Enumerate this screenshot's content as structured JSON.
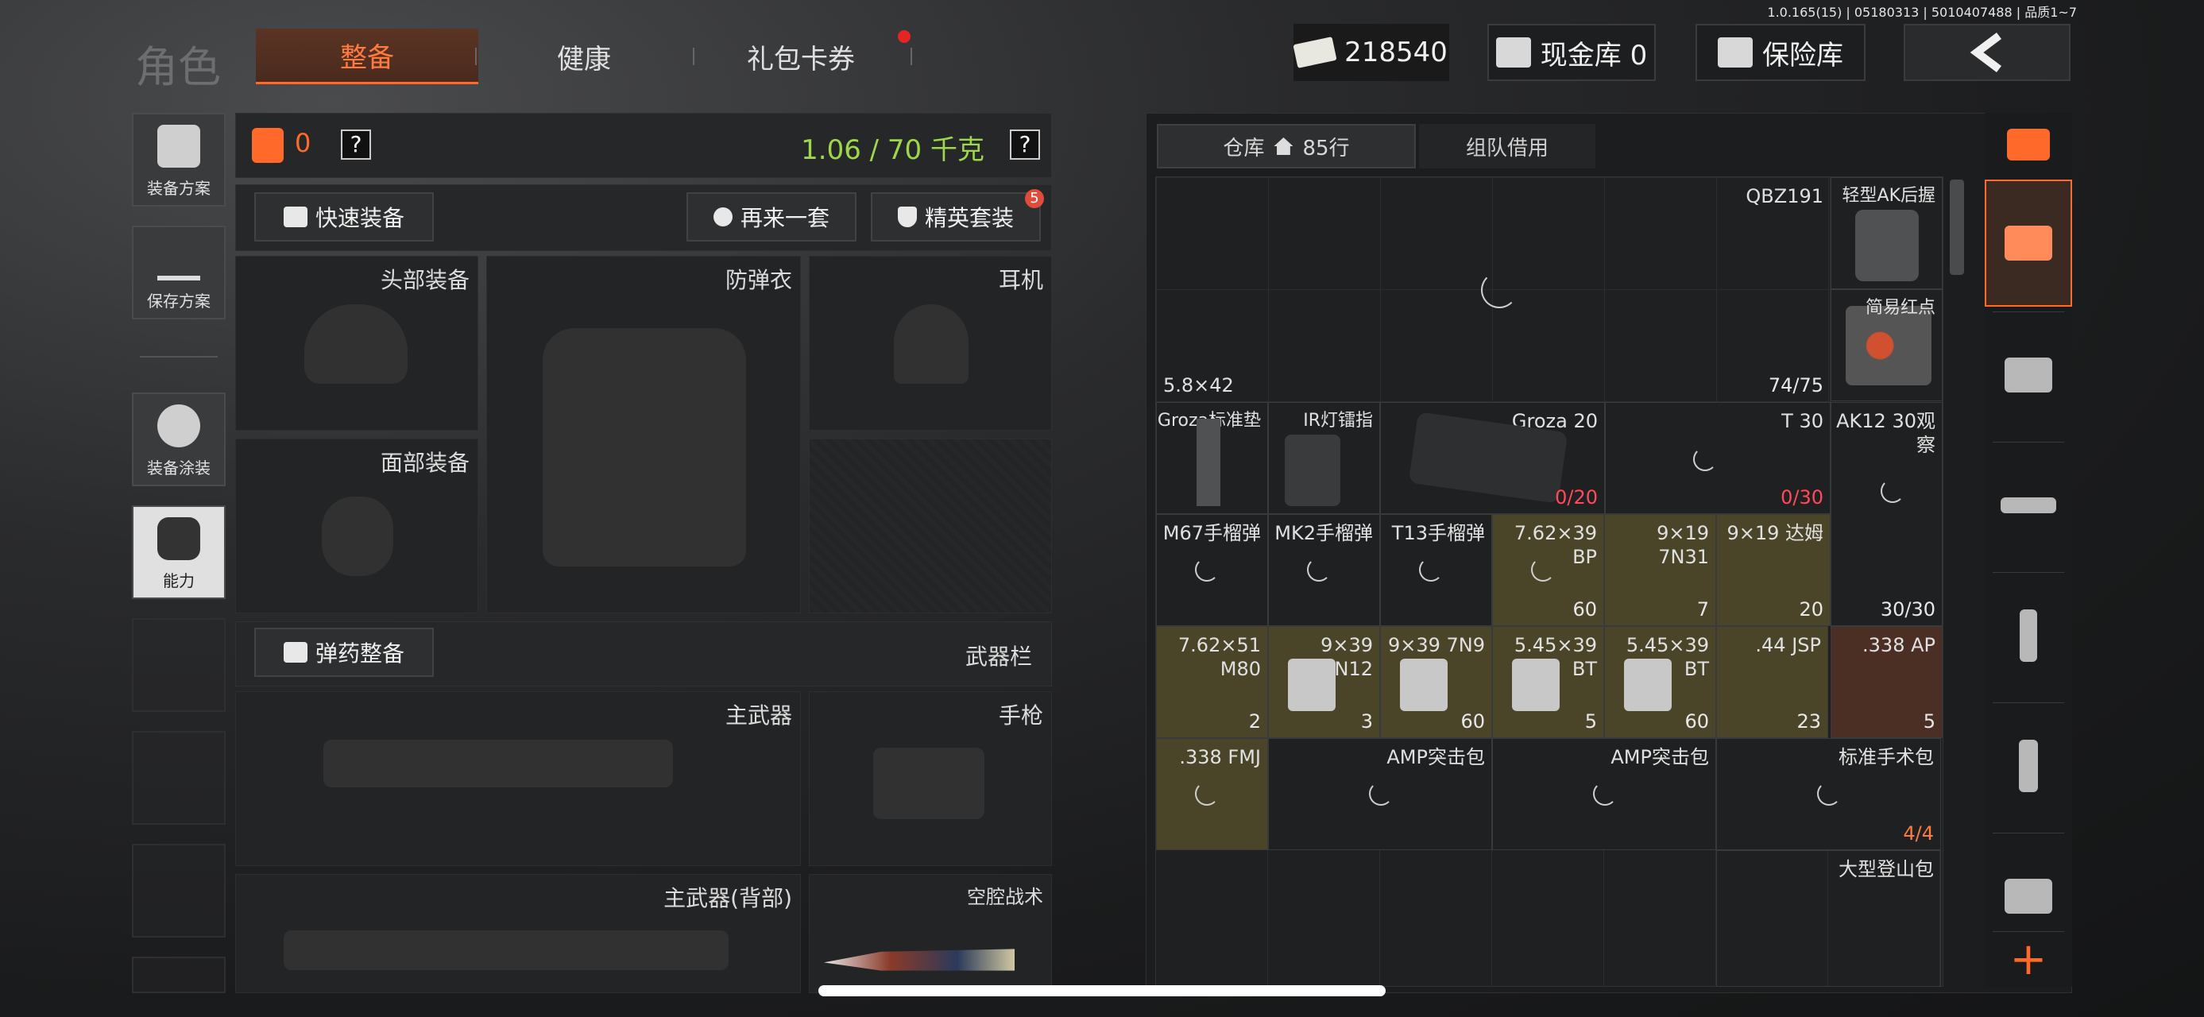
{
  "version": "1.0.165(15) | 05180313 | 5010407488 | 品质1~7",
  "header": {
    "title": "角色",
    "tabs": [
      "整备",
      "健康",
      "礼包卡券"
    ],
    "currency": "218540",
    "cash_vault": "现金库 0",
    "safe": "保险库"
  },
  "sidebar": {
    "loadout": "装备方案",
    "save": "保存方案",
    "skin": "装备涂装",
    "ability": "能力"
  },
  "equip": {
    "armor_count": "0",
    "weight": "1.06 / 70 千克",
    "quick_equip": "快速装备",
    "again": "再来一套",
    "elite": "精英套装",
    "elite_badge": "5",
    "head": "头部装备",
    "vest": "防弹衣",
    "headset": "耳机",
    "face": "面部装备",
    "ammo_equip": "弹药整备",
    "weapon_bar": "武器栏",
    "primary": "主武器",
    "pistol": "手枪",
    "primary_back": "主武器(背部)",
    "melee": "空腔战术"
  },
  "storage": {
    "tab_storage": "仓库",
    "rows": "85行",
    "tab_team": "组队借用",
    "items": [
      {
        "name": "QBZ191",
        "sub": "5.8×42",
        "count": "74/75"
      },
      {
        "name": "轻型AK后握",
        "count": ""
      },
      {
        "name": "简易红点",
        "count": ""
      },
      {
        "name": "Groza标准垫",
        "count": ""
      },
      {
        "name": "IR灯镭指",
        "count": ""
      },
      {
        "name": "Groza 20",
        "count": "0/20"
      },
      {
        "name": "T 30",
        "count": "0/30"
      },
      {
        "name": "AK12 30观察",
        "count": "30/30"
      },
      {
        "name": "M67手榴弹",
        "count": ""
      },
      {
        "name": "MK2手榴弹",
        "count": ""
      },
      {
        "name": "T13手榴弹",
        "count": ""
      },
      {
        "name": "7.62×39 BP",
        "count": "60"
      },
      {
        "name": "9×19 7N31",
        "count": "7"
      },
      {
        "name": "9×19 达姆",
        "count": "20"
      },
      {
        "name": "7.62×51 M80",
        "count": "2"
      },
      {
        "name": "9×39 7N12",
        "count": "3"
      },
      {
        "name": "9×39 7N9",
        "count": "60"
      },
      {
        "name": "5.45×39 BT",
        "count": "5"
      },
      {
        "name": "5.45×39 BT",
        "count": "60"
      },
      {
        "name": ".44 JSP",
        "count": "23"
      },
      {
        "name": ".338 AP",
        "count": "5"
      },
      {
        "name": ".338 FMJ",
        "count": ""
      },
      {
        "name": "AMP突击包",
        "count": ""
      },
      {
        "name": "AMP突击包",
        "count": ""
      },
      {
        "name": "标准手术包",
        "count": "4/4"
      },
      {
        "name": "大型登山包",
        "count": ""
      }
    ]
  },
  "colors": {
    "accent": "#ff6a2a",
    "weight": "#9ed84a",
    "warn": "#ff4a5a"
  }
}
